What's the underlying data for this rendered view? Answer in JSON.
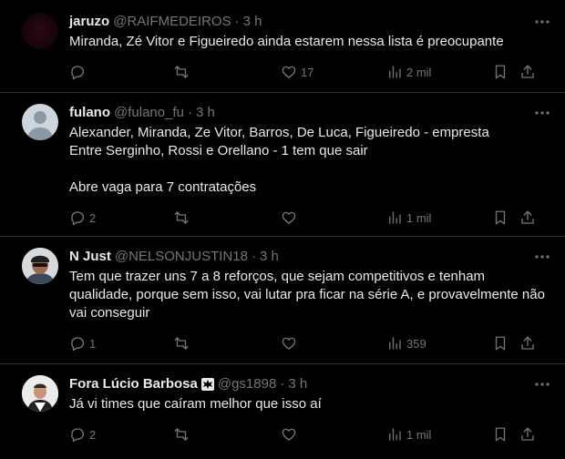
{
  "tweets": [
    {
      "name": "jaruzo",
      "handle": "@RAIFMEDEIROS",
      "sep": "·",
      "time": "3 h",
      "text": "Miranda, Zé Vitor e Figueiredo ainda estarem nessa lista é preocupante",
      "replies": "",
      "reposts": "",
      "likes": "17",
      "views": "2 mil"
    },
    {
      "name": "fulano",
      "handle": "@fulano_fu",
      "sep": "·",
      "time": "3 h",
      "text": "Alexander, Miranda, Ze Vitor, Barros, De Luca, Figueiredo - empresta\nEntre Serginho, Rossi e Orellano - 1 tem que sair\n\nAbre vaga para 7 contratações",
      "replies": "2",
      "reposts": "",
      "likes": "",
      "views": "1 mil"
    },
    {
      "name": "N Just",
      "handle": "@NELSONJUSTIN18",
      "sep": "·",
      "time": "3 h",
      "text": "Tem que trazer uns 7 a 8 reforços, que sejam competitivos e tenham qualidade, porque sem isso, vai lutar pra ficar na série A, e provavelmente não vai conseguir",
      "replies": "1",
      "reposts": "",
      "likes": "",
      "views": "359"
    },
    {
      "name": "Fora Lúcio Barbosa",
      "handle": "@gs1898",
      "sep": "·",
      "time": "3 h",
      "text": "Já vi times que caíram melhor que isso aí",
      "replies": "2",
      "reposts": "",
      "likes": "",
      "views": "1 mil"
    }
  ],
  "icons": {
    "more": "more-icon",
    "reply": "reply-icon",
    "repost": "repost-icon",
    "like": "like-icon",
    "views": "views-icon",
    "bookmark": "bookmark-icon",
    "share": "share-icon",
    "badge": "maltese-cross-icon"
  },
  "colors": {
    "background": "#000000",
    "text": "#e7e9ea",
    "muted": "#71767b",
    "divider": "#2f3336"
  }
}
